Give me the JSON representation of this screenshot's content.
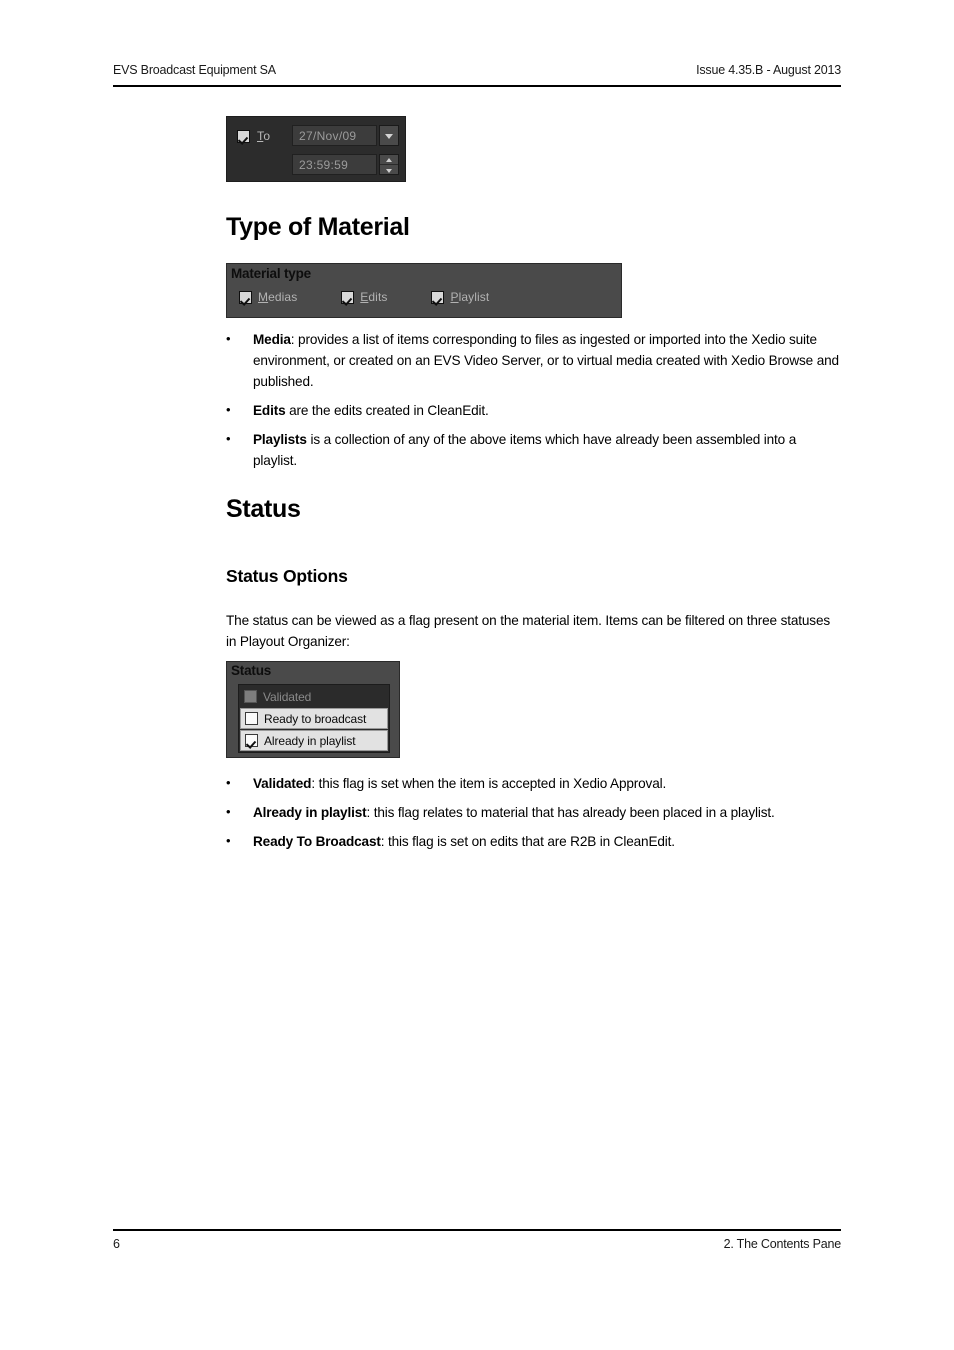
{
  "header": {
    "left": "EVS Broadcast Equipment SA",
    "right": "Issue 4.35.B - August 2013"
  },
  "footer": {
    "page_number": "6",
    "chapter": "2. The Contents Pane"
  },
  "datetime_widget": {
    "checkbox_label_accel": "T",
    "checkbox_label_rest": "o",
    "checkbox_checked": true,
    "date_value": "27/Nov/09",
    "time_value": "23:59:59"
  },
  "sections": {
    "type_of_material": {
      "heading": "Type of Material",
      "material_type_widget": {
        "title": "Material type",
        "options": [
          {
            "accel": "M",
            "rest": "edias",
            "checked": true
          },
          {
            "accel": "E",
            "rest": "dits",
            "checked": true
          },
          {
            "accel": "P",
            "rest": "laylist",
            "checked": true
          }
        ]
      },
      "bullets": [
        {
          "term": "Media",
          "text": ": provides a list of items corresponding to files as ingested or imported into the Xedio suite environment, or created on an EVS Video Server, or to virtual media created with Xedio Browse and published."
        },
        {
          "term": "Edits",
          "text": " are the edits created in CleanEdit."
        },
        {
          "term": "Playlists",
          "text": " is a collection of any of the above items which have already been assembled into a playlist."
        }
      ]
    },
    "status": {
      "heading": "Status",
      "subheading": "Status Options",
      "intro": "The status can be viewed as a flag present on the material item. Items can be filtered on three statuses in Playout Organizer:",
      "status_widget": {
        "title": "Status",
        "rows": [
          {
            "label": "Validated",
            "checked": false,
            "enabled": false
          },
          {
            "label": "Ready to broadcast",
            "checked": false,
            "enabled": true
          },
          {
            "label": "Already in playlist",
            "checked": true,
            "enabled": true
          }
        ]
      },
      "bullets": [
        {
          "term": "Validated",
          "text": ": this flag is set when the item is accepted in Xedio Approval."
        },
        {
          "term": "Already in playlist",
          "text": ": this flag relates to material that has already been placed in a playlist."
        },
        {
          "term": "Ready To Broadcast",
          "text": ": this flag is set on edits that are R2B in CleanEdit."
        }
      ]
    }
  }
}
